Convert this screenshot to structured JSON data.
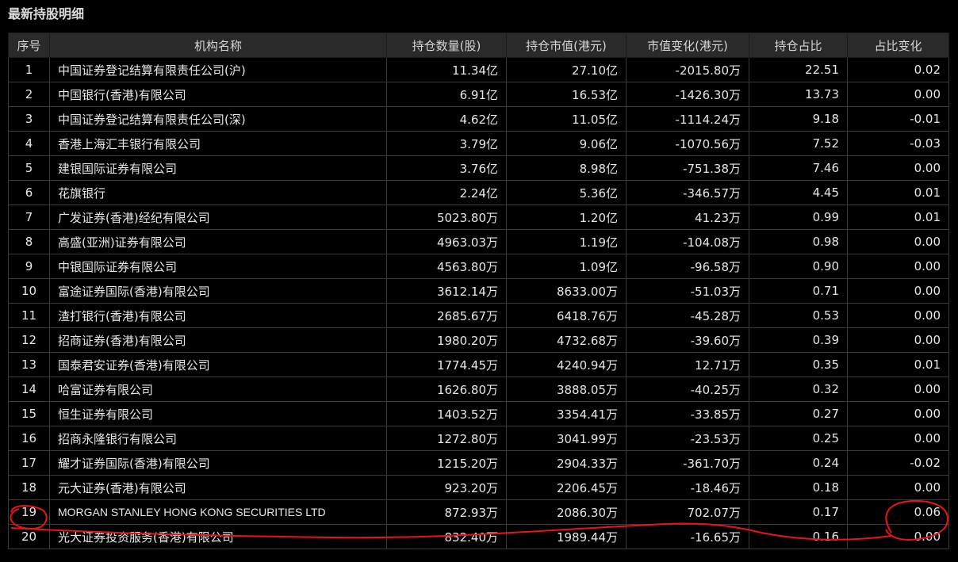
{
  "panel": {
    "title": "最新持股明细"
  },
  "table": {
    "headers": [
      "序号",
      "机构名称",
      "持仓数量(股)",
      "持仓市值(港元)",
      "市值变化(港元)",
      "持仓占比",
      "占比变化"
    ],
    "rows": [
      {
        "no": "1",
        "name": "中国证券登记结算有限责任公司(沪)",
        "shares": "11.34亿",
        "value": "27.10亿",
        "change": "-2015.80万",
        "ratio": "22.51",
        "ratio_change": "0.02"
      },
      {
        "no": "2",
        "name": "中国银行(香港)有限公司",
        "shares": "6.91亿",
        "value": "16.53亿",
        "change": "-1426.30万",
        "ratio": "13.73",
        "ratio_change": "0.00"
      },
      {
        "no": "3",
        "name": "中国证券登记结算有限责任公司(深)",
        "shares": "4.62亿",
        "value": "11.05亿",
        "change": "-1114.24万",
        "ratio": "9.18",
        "ratio_change": "-0.01"
      },
      {
        "no": "4",
        "name": "香港上海汇丰银行有限公司",
        "shares": "3.79亿",
        "value": "9.06亿",
        "change": "-1070.56万",
        "ratio": "7.52",
        "ratio_change": "-0.03"
      },
      {
        "no": "5",
        "name": "建银国际证券有限公司",
        "shares": "3.76亿",
        "value": "8.98亿",
        "change": "-751.38万",
        "ratio": "7.46",
        "ratio_change": "0.00"
      },
      {
        "no": "6",
        "name": "花旗银行",
        "shares": "2.24亿",
        "value": "5.36亿",
        "change": "-346.57万",
        "ratio": "4.45",
        "ratio_change": "0.01"
      },
      {
        "no": "7",
        "name": "广发证券(香港)经纪有限公司",
        "shares": "5023.80万",
        "value": "1.20亿",
        "change": "41.23万",
        "ratio": "0.99",
        "ratio_change": "0.01"
      },
      {
        "no": "8",
        "name": "高盛(亚洲)证券有限公司",
        "shares": "4963.03万",
        "value": "1.19亿",
        "change": "-104.08万",
        "ratio": "0.98",
        "ratio_change": "0.00"
      },
      {
        "no": "9",
        "name": "中银国际证券有限公司",
        "shares": "4563.80万",
        "value": "1.09亿",
        "change": "-96.58万",
        "ratio": "0.90",
        "ratio_change": "0.00"
      },
      {
        "no": "10",
        "name": "富途证券国际(香港)有限公司",
        "shares": "3612.14万",
        "value": "8633.00万",
        "change": "-51.03万",
        "ratio": "0.71",
        "ratio_change": "0.00"
      },
      {
        "no": "11",
        "name": "渣打银行(香港)有限公司",
        "shares": "2685.67万",
        "value": "6418.76万",
        "change": "-45.28万",
        "ratio": "0.53",
        "ratio_change": "0.00"
      },
      {
        "no": "12",
        "name": "招商证券(香港)有限公司",
        "shares": "1980.20万",
        "value": "4732.68万",
        "change": "-39.60万",
        "ratio": "0.39",
        "ratio_change": "0.00"
      },
      {
        "no": "13",
        "name": "国泰君安证券(香港)有限公司",
        "shares": "1774.45万",
        "value": "4240.94万",
        "change": "12.71万",
        "ratio": "0.35",
        "ratio_change": "0.01"
      },
      {
        "no": "14",
        "name": "哈富证券有限公司",
        "shares": "1626.80万",
        "value": "3888.05万",
        "change": "-40.25万",
        "ratio": "0.32",
        "ratio_change": "0.00"
      },
      {
        "no": "15",
        "name": "恒生证券有限公司",
        "shares": "1403.52万",
        "value": "3354.41万",
        "change": "-33.85万",
        "ratio": "0.27",
        "ratio_change": "0.00"
      },
      {
        "no": "16",
        "name": "招商永隆银行有限公司",
        "shares": "1272.80万",
        "value": "3041.99万",
        "change": "-23.53万",
        "ratio": "0.25",
        "ratio_change": "0.00"
      },
      {
        "no": "17",
        "name": "耀才证券国际(香港)有限公司",
        "shares": "1215.20万",
        "value": "2904.33万",
        "change": "-361.70万",
        "ratio": "0.24",
        "ratio_change": "-0.02"
      },
      {
        "no": "18",
        "name": "元大证券(香港)有限公司",
        "shares": "923.20万",
        "value": "2206.45万",
        "change": "-18.46万",
        "ratio": "0.18",
        "ratio_change": "0.00"
      },
      {
        "no": "19",
        "name": "MORGAN STANLEY HONG KONG SECURITIES LTD",
        "shares": "872.93万",
        "value": "2086.30万",
        "change": "702.07万",
        "ratio": "0.17",
        "ratio_change": "0.06"
      },
      {
        "no": "20",
        "name": "光大证券投资服务(香港)有限公司",
        "shares": "832.40万",
        "value": "1989.44万",
        "change": "-16.65万",
        "ratio": "0.16",
        "ratio_change": "0.00"
      }
    ]
  },
  "colors": {
    "background": "#000000",
    "header_bg": "#2a2a2a",
    "text": "#e6e6e6",
    "grid": "#3a3a3a",
    "annotation": "#e8141c"
  }
}
